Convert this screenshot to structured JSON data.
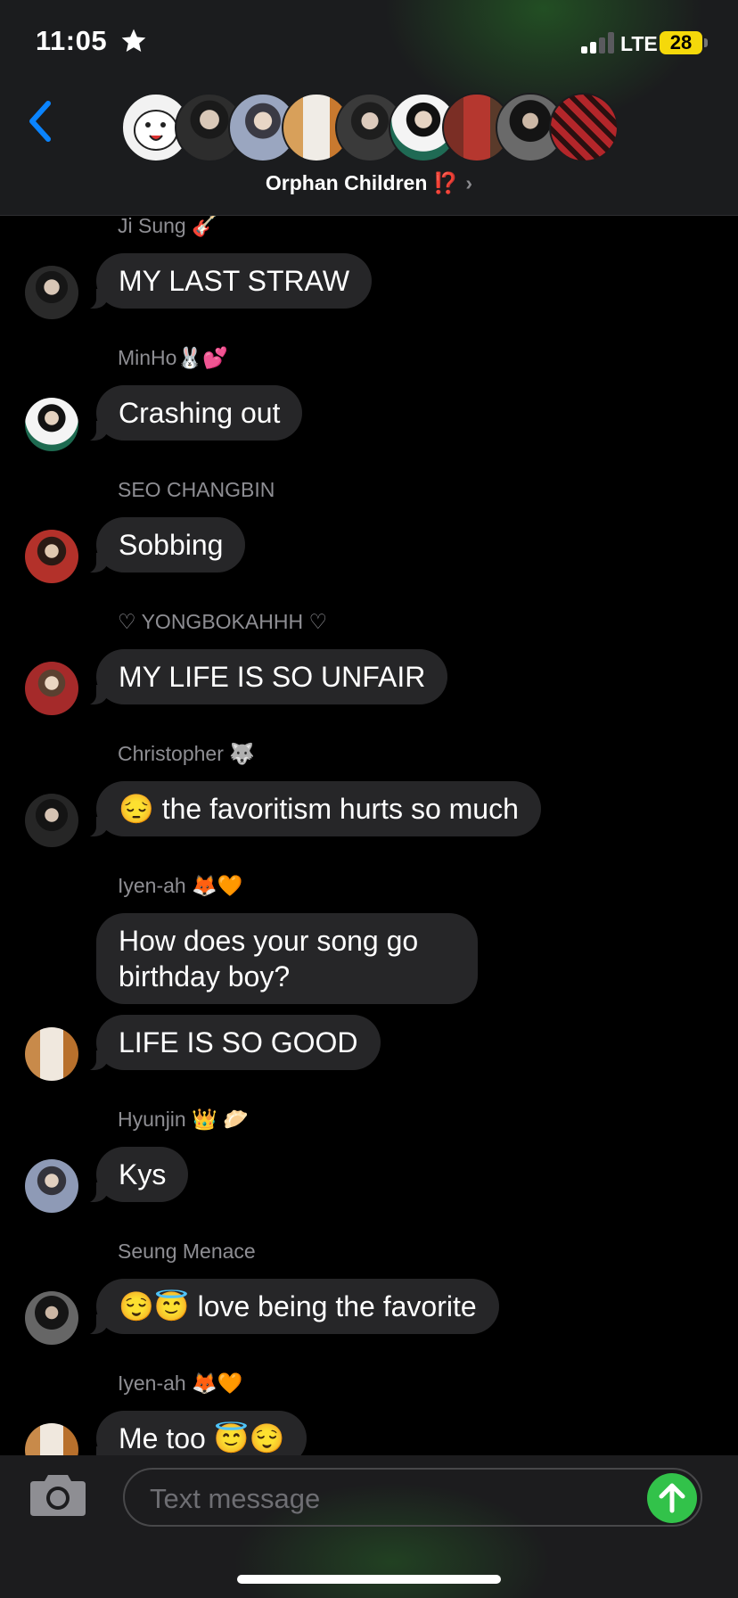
{
  "status_bar": {
    "time": "11:05",
    "network": "LTE",
    "battery": "28"
  },
  "header": {
    "group_name": "Orphan Children ⁉️",
    "chevron": "›",
    "back_icon": "chevron-left-icon",
    "participant_avatar_count": 9
  },
  "messages": [
    {
      "sender": "Ji Sung 🎸",
      "text": "MY LAST STRAW"
    },
    {
      "sender": "MinHo🐰💕",
      "text": "Crashing out"
    },
    {
      "sender": "SEO CHANGBIN",
      "text": "Sobbing"
    },
    {
      "sender": "♡ YONGBOKAHHH ♡",
      "text": "MY LIFE IS SO UNFAIR"
    },
    {
      "sender": "Christopher 🐺",
      "text": "😔 the favoritism hurts so much"
    },
    {
      "sender": "Iyen-ah 🦊🧡",
      "text": "How does your song go birthday boy?"
    },
    {
      "sender": "",
      "text": "LIFE IS SO GOOD"
    },
    {
      "sender": "Hyunjin 👑 🥟",
      "text": "Kys"
    },
    {
      "sender": "Seung Menace",
      "text": "😌😇 love being the favorite"
    },
    {
      "sender": "Iyen-ah 🦊🧡",
      "text": "Me too 😇😌"
    }
  ],
  "composer": {
    "placeholder": "Text message",
    "camera_icon": "camera-icon",
    "send_icon": "arrow-up-icon"
  },
  "colors": {
    "background": "#000000",
    "bubble": "#262628",
    "accent_blue": "#0a84ff",
    "send_green": "#32c24a",
    "battery_yellow": "#f5d90a"
  }
}
